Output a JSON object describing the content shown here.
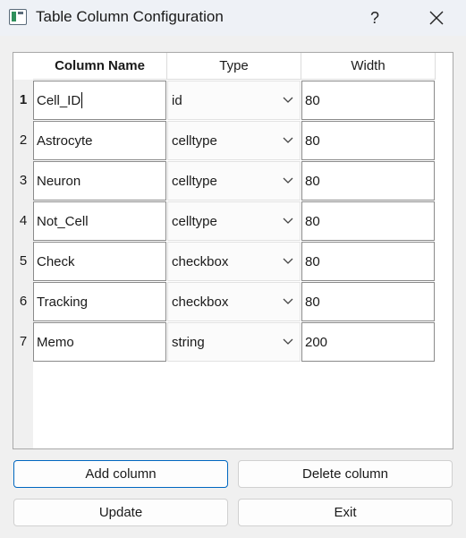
{
  "window": {
    "title": "Table Column Configuration",
    "help_label": "?",
    "close_icon": "close-icon",
    "app_icon": "app-icon"
  },
  "table": {
    "headers": [
      "Column Name",
      "Type",
      "Width"
    ],
    "rows": [
      {
        "num": "1",
        "name": "Cell_ID",
        "type": "id",
        "width": "80"
      },
      {
        "num": "2",
        "name": "Astrocyte",
        "type": "celltype",
        "width": "80"
      },
      {
        "num": "3",
        "name": "Neuron",
        "type": "celltype",
        "width": "80"
      },
      {
        "num": "4",
        "name": "Not_Cell",
        "type": "celltype",
        "width": "80"
      },
      {
        "num": "5",
        "name": "Check",
        "type": "checkbox",
        "width": "80"
      },
      {
        "num": "6",
        "name": "Tracking",
        "type": "checkbox",
        "width": "80"
      },
      {
        "num": "7",
        "name": "Memo",
        "type": "string",
        "width": "200"
      }
    ]
  },
  "buttons": {
    "add_column": "Add column",
    "delete_column": "Delete column",
    "update": "Update",
    "exit": "Exit"
  },
  "colors": {
    "focus_border": "#0067c0",
    "cell_border": "#8a8a8a",
    "titlebar_bg": "#eef1f6"
  }
}
